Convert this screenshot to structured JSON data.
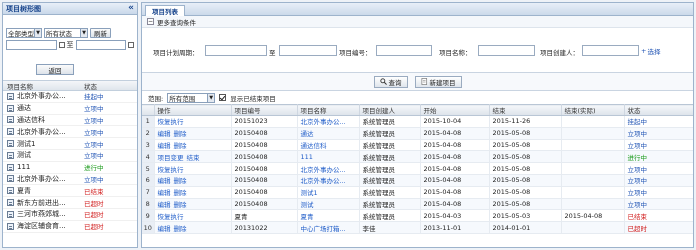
{
  "left_panel": {
    "title": "项目树形图",
    "collapse_icon": "double-chevron-left-icon",
    "type_select": "全部类型",
    "status_select": "所有状态",
    "refresh_label": "刷新",
    "to_label": "至",
    "back_label": "返回",
    "col_name": "项目名称",
    "col_status": "状态",
    "items": [
      {
        "name": "北京外事办公...",
        "status": "挂起中",
        "color": "#2356b5"
      },
      {
        "name": "通达",
        "status": "立项中",
        "color": "#2356b5"
      },
      {
        "name": "通达信科",
        "status": "立项中",
        "color": "#2356b5"
      },
      {
        "name": "北京外事办公...",
        "status": "立项中",
        "color": "#2356b5"
      },
      {
        "name": "测试1",
        "status": "立项中",
        "color": "#2356b5"
      },
      {
        "name": "测试",
        "status": "立项中",
        "color": "#2356b5"
      },
      {
        "name": "111",
        "status": "进行中",
        "color": "#1a9a1a"
      },
      {
        "name": "北京外事办公...",
        "status": "立项中",
        "color": "#2356b5"
      },
      {
        "name": "夏青",
        "status": "已结束",
        "color": "#d01818"
      },
      {
        "name": "新东方前进出...",
        "status": "已超时",
        "color": "#d01818"
      },
      {
        "name": "三河市燕郊城...",
        "status": "已超时",
        "color": "#d01818"
      },
      {
        "name": "海淀区辅食育...",
        "status": "已超时",
        "color": "#d01818"
      }
    ]
  },
  "right_panel": {
    "tab": "项目列表",
    "more_conditions": "更多查询条件",
    "fields": {
      "period_label": "项目计划周期：",
      "to_label": "至",
      "code_label": "项目编号：",
      "name_label": "项目名称：",
      "creator_label": "项目创建人：",
      "add_select": "选择"
    },
    "query_label": "查询",
    "new_label": "新建项目",
    "scope_label": "范围:",
    "scope_value": "所有范围",
    "show_finished_label": "显示已结束项目",
    "columns": [
      "操作",
      "项目编号",
      "项目名称",
      "项目创建人",
      "开始",
      "结束",
      "结束(实际)",
      "状态"
    ],
    "rows": [
      {
        "n": "1",
        "ops": [
          "恢复执行"
        ],
        "code": "20151023",
        "name": "北京外事办公...",
        "creator": "系统管理员",
        "start": "2015-10-04",
        "end": "2015-11-26",
        "actual": "",
        "status": "挂起中",
        "status_color": "#2356b5"
      },
      {
        "n": "2",
        "ops": [
          "编辑",
          "删除"
        ],
        "code": "20150408",
        "name": "通达",
        "creator": "系统管理员",
        "start": "2015-04-08",
        "end": "2015-05-08",
        "actual": "",
        "status": "立项中",
        "status_color": "#2356b5"
      },
      {
        "n": "3",
        "ops": [
          "编辑",
          "删除"
        ],
        "code": "20150408",
        "name": "通达信科",
        "creator": "系统管理员",
        "start": "2015-04-08",
        "end": "2015-05-08",
        "actual": "",
        "status": "立项中",
        "status_color": "#2356b5"
      },
      {
        "n": "4",
        "ops": [
          "项目变更",
          "结束"
        ],
        "code": "20150408",
        "name": "111",
        "creator": "系统管理员",
        "start": "2015-04-08",
        "end": "2015-05-08",
        "actual": "",
        "status": "进行中",
        "status_color": "#1a9a1a"
      },
      {
        "n": "5",
        "ops": [
          "恢复执行"
        ],
        "code": "20150408",
        "name": "北京外事办公...",
        "creator": "系统管理员",
        "start": "2015-04-08",
        "end": "2015-05-08",
        "actual": "",
        "status": "立项中",
        "status_color": "#2356b5"
      },
      {
        "n": "6",
        "ops": [
          "编辑",
          "删除"
        ],
        "code": "20150408",
        "name": "北京外事办公...",
        "creator": "系统管理员",
        "start": "2015-04-08",
        "end": "2015-05-08",
        "actual": "",
        "status": "立项中",
        "status_color": "#2356b5"
      },
      {
        "n": "7",
        "ops": [
          "编辑",
          "删除"
        ],
        "code": "20150408",
        "name": "测试1",
        "creator": "系统管理员",
        "start": "2015-04-08",
        "end": "2015-05-08",
        "actual": "",
        "status": "立项中",
        "status_color": "#2356b5"
      },
      {
        "n": "8",
        "ops": [
          "编辑",
          "删除"
        ],
        "code": "20150408",
        "name": "测试",
        "creator": "系统管理员",
        "start": "2015-04-08",
        "end": "2015-05-08",
        "actual": "",
        "status": "立项中",
        "status_color": "#2356b5"
      },
      {
        "n": "9",
        "ops": [
          "恢复执行"
        ],
        "code": "夏青",
        "name": "夏青",
        "creator": "系统管理员",
        "start": "2015-04-03",
        "end": "2015-05-03",
        "actual": "2015-04-08",
        "status": "已结束",
        "status_color": "#d01818"
      },
      {
        "n": "10",
        "ops": [
          "编辑",
          "删除"
        ],
        "code": "20131022",
        "name": "中心广场打箱...",
        "creator": "李佳",
        "start": "2013-11-01",
        "end": "2014-01-01",
        "actual": "",
        "status": "已超时",
        "status_color": "#d01818"
      }
    ]
  }
}
